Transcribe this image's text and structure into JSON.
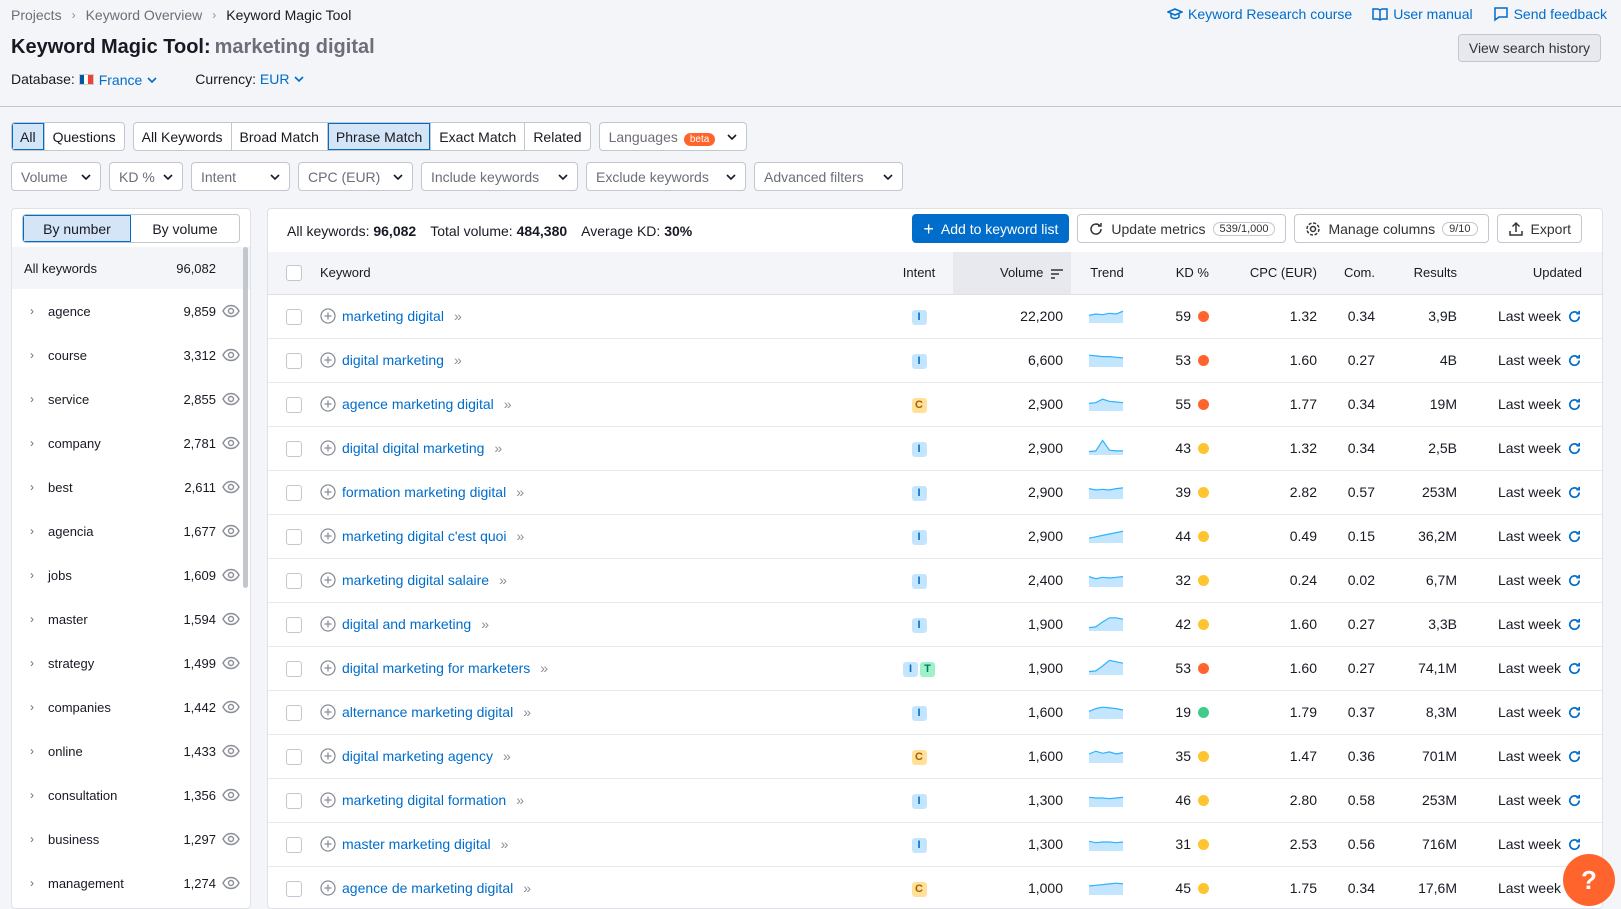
{
  "breadcrumb": [
    "Projects",
    "Keyword Overview",
    "Keyword Magic Tool"
  ],
  "top_links": [
    {
      "label": "Keyword Research course",
      "icon": "graduation-cap-icon"
    },
    {
      "label": "User manual",
      "icon": "book-icon"
    },
    {
      "label": "Send feedback",
      "icon": "chat-icon"
    }
  ],
  "title": {
    "tool": "Keyword Magic Tool:",
    "query": "marketing digital"
  },
  "history_button": "View search history",
  "database": {
    "label": "Database:",
    "value": "France"
  },
  "currency": {
    "label": "Currency:",
    "value": "EUR"
  },
  "tabs_scope": [
    "All",
    "Questions"
  ],
  "tabs_match": [
    "All Keywords",
    "Broad Match",
    "Phrase Match",
    "Exact Match",
    "Related"
  ],
  "active_scope": "All",
  "active_match": "Phrase Match",
  "languages": {
    "label": "Languages",
    "badge": "beta"
  },
  "filters": [
    "Volume",
    "KD %",
    "Intent",
    "CPC (EUR)",
    "Include keywords",
    "Exclude keywords",
    "Advanced filters"
  ],
  "sidebar": {
    "toggle": [
      "By number",
      "By volume"
    ],
    "all_label": "All keywords",
    "all_count": "96,082",
    "groups": [
      {
        "label": "agence",
        "count": "9,859"
      },
      {
        "label": "course",
        "count": "3,312"
      },
      {
        "label": "service",
        "count": "2,855"
      },
      {
        "label": "company",
        "count": "2,781"
      },
      {
        "label": "best",
        "count": "2,611"
      },
      {
        "label": "agencia",
        "count": "1,677"
      },
      {
        "label": "jobs",
        "count": "1,609"
      },
      {
        "label": "master",
        "count": "1,594"
      },
      {
        "label": "strategy",
        "count": "1,499"
      },
      {
        "label": "companies",
        "count": "1,442"
      },
      {
        "label": "online",
        "count": "1,433"
      },
      {
        "label": "consultation",
        "count": "1,356"
      },
      {
        "label": "business",
        "count": "1,297"
      },
      {
        "label": "management",
        "count": "1,274"
      }
    ]
  },
  "summary": {
    "all_label": "All keywords:",
    "all_value": "96,082",
    "vol_label": "Total volume:",
    "vol_value": "484,380",
    "kd_label": "Average KD:",
    "kd_value": "30%"
  },
  "actions": {
    "add": "Add to keyword list",
    "update": "Update metrics",
    "update_pill": "539/1,000",
    "columns": "Manage columns",
    "columns_pill": "9/10",
    "export": "Export"
  },
  "columns": [
    "Keyword",
    "Intent",
    "Volume",
    "Trend",
    "KD %",
    "CPC (EUR)",
    "Com.",
    "Results",
    "Updated"
  ],
  "kd_colors": {
    "high": "#ff642d",
    "mid": "#ffc530",
    "low": "#3fcc8b"
  },
  "rows": [
    {
      "keyword": "marketing digital",
      "intent": [
        "I"
      ],
      "volume": "22,200",
      "trend": [
        0.6,
        0.5,
        0.55,
        0.45,
        0.5,
        0.3
      ],
      "kd": "59",
      "kd_level": "high",
      "cpc": "1.32",
      "com": "0.34",
      "results": "3,9B",
      "updated": "Last week"
    },
    {
      "keyword": "digital marketing",
      "intent": [
        "I"
      ],
      "volume": "6,600",
      "trend": [
        0.3,
        0.35,
        0.4,
        0.4,
        0.45,
        0.5
      ],
      "kd": "53",
      "kd_level": "high",
      "cpc": "1.60",
      "com": "0.27",
      "results": "4B",
      "updated": "Last week"
    },
    {
      "keyword": "agence marketing digital",
      "intent": [
        "C"
      ],
      "volume": "2,900",
      "trend": [
        0.6,
        0.55,
        0.3,
        0.45,
        0.5,
        0.55
      ],
      "kd": "55",
      "kd_level": "high",
      "cpc": "1.77",
      "com": "0.34",
      "results": "19M",
      "updated": "Last week"
    },
    {
      "keyword": "digital digital marketing",
      "intent": [
        "I"
      ],
      "volume": "2,900",
      "trend": [
        0.9,
        0.85,
        0.1,
        0.8,
        0.85,
        0.85
      ],
      "kd": "43",
      "kd_level": "mid",
      "cpc": "1.32",
      "com": "0.34",
      "results": "2,5B",
      "updated": "Last week"
    },
    {
      "keyword": "formation marketing digital",
      "intent": [
        "I"
      ],
      "volume": "2,900",
      "trend": [
        0.4,
        0.5,
        0.45,
        0.5,
        0.4,
        0.35
      ],
      "kd": "39",
      "kd_level": "mid",
      "cpc": "2.82",
      "com": "0.57",
      "results": "253M",
      "updated": "Last week"
    },
    {
      "keyword": "marketing digital c'est quoi",
      "intent": [
        "I"
      ],
      "volume": "2,900",
      "trend": [
        0.8,
        0.7,
        0.6,
        0.5,
        0.4,
        0.3
      ],
      "kd": "44",
      "kd_level": "mid",
      "cpc": "0.49",
      "com": "0.15",
      "results": "36,2M",
      "updated": "Last week"
    },
    {
      "keyword": "marketing digital salaire",
      "intent": [
        "I"
      ],
      "volume": "2,400",
      "trend": [
        0.4,
        0.55,
        0.45,
        0.5,
        0.45,
        0.4
      ],
      "kd": "32",
      "kd_level": "mid",
      "cpc": "0.24",
      "com": "0.02",
      "results": "6,7M",
      "updated": "Last week"
    },
    {
      "keyword": "digital and marketing",
      "intent": [
        "I"
      ],
      "volume": "1,900",
      "trend": [
        0.9,
        0.85,
        0.5,
        0.2,
        0.2,
        0.3
      ],
      "kd": "42",
      "kd_level": "mid",
      "cpc": "1.60",
      "com": "0.27",
      "results": "3,3B",
      "updated": "Last week"
    },
    {
      "keyword": "digital marketing for marketers",
      "intent": [
        "I",
        "T"
      ],
      "volume": "1,900",
      "trend": [
        0.9,
        0.85,
        0.5,
        0.1,
        0.2,
        0.3
      ],
      "kd": "53",
      "kd_level": "high",
      "cpc": "1.60",
      "com": "0.27",
      "results": "74,1M",
      "updated": "Last week"
    },
    {
      "keyword": "alternance marketing digital",
      "intent": [
        "I"
      ],
      "volume": "1,600",
      "trend": [
        0.6,
        0.4,
        0.3,
        0.35,
        0.4,
        0.5
      ],
      "kd": "19",
      "kd_level": "low",
      "cpc": "1.79",
      "com": "0.37",
      "results": "8,3M",
      "updated": "Last week"
    },
    {
      "keyword": "digital marketing agency",
      "intent": [
        "C"
      ],
      "volume": "1,600",
      "trend": [
        0.5,
        0.3,
        0.45,
        0.35,
        0.5,
        0.4
      ],
      "kd": "35",
      "kd_level": "mid",
      "cpc": "1.47",
      "com": "0.36",
      "results": "701M",
      "updated": "Last week"
    },
    {
      "keyword": "marketing digital formation",
      "intent": [
        "I"
      ],
      "volume": "1,300",
      "trend": [
        0.45,
        0.5,
        0.5,
        0.55,
        0.5,
        0.45
      ],
      "kd": "46",
      "kd_level": "mid",
      "cpc": "2.80",
      "com": "0.58",
      "results": "253M",
      "updated": "Last week"
    },
    {
      "keyword": "master marketing digital",
      "intent": [
        "I"
      ],
      "volume": "1,300",
      "trend": [
        0.45,
        0.55,
        0.5,
        0.5,
        0.55,
        0.5
      ],
      "kd": "31",
      "kd_level": "mid",
      "cpc": "2.53",
      "com": "0.56",
      "results": "716M",
      "updated": "Last week"
    },
    {
      "keyword": "agence de marketing digital",
      "intent": [
        "C"
      ],
      "volume": "1,000",
      "trend": [
        0.5,
        0.45,
        0.4,
        0.35,
        0.3,
        0.35
      ],
      "kd": "45",
      "kd_level": "mid",
      "cpc": "1.75",
      "com": "0.34",
      "results": "17,6M",
      "updated": "Last week"
    }
  ],
  "help_icon": "?"
}
